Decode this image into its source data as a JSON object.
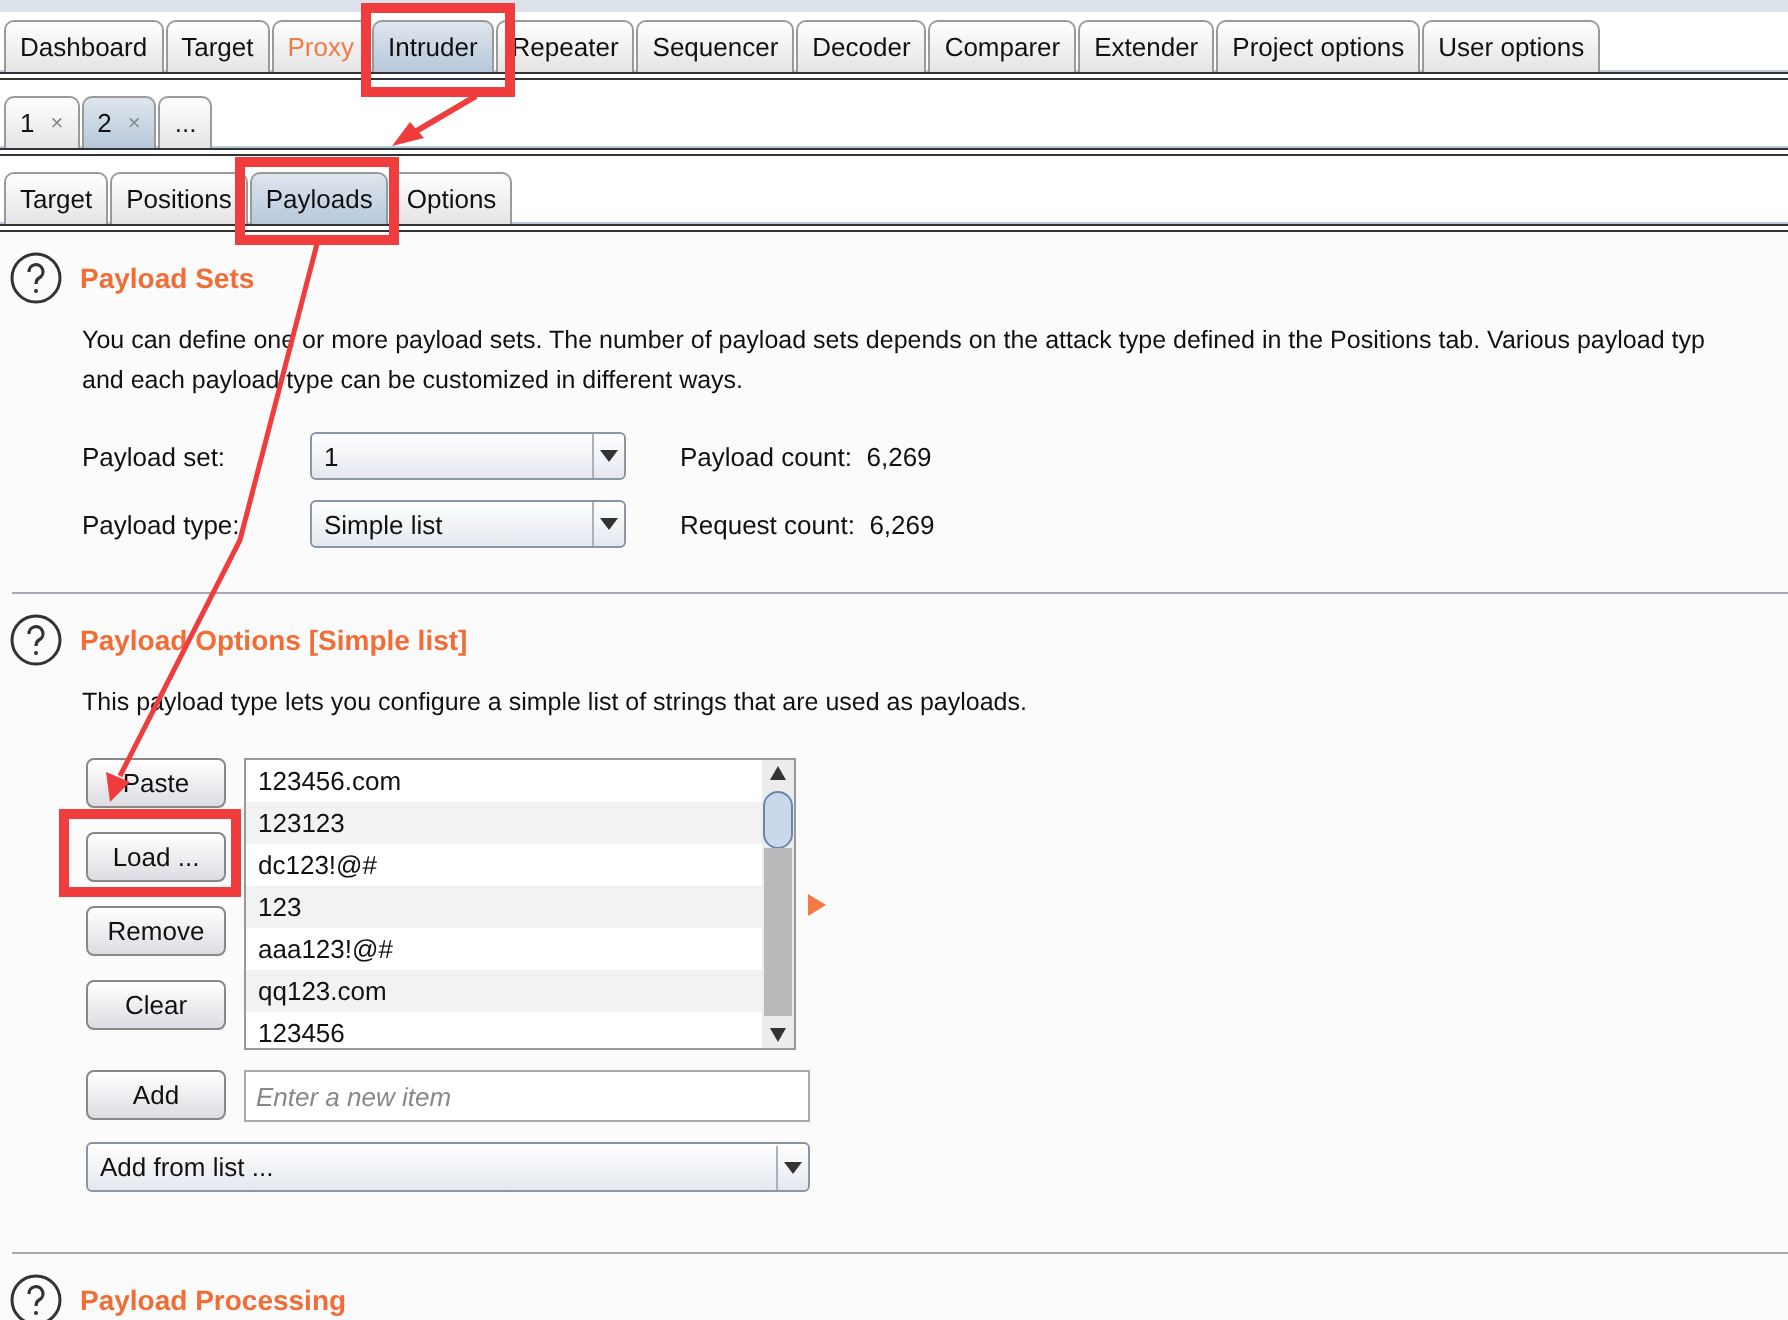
{
  "main_tabs": [
    {
      "label": "Dashboard",
      "selected": false,
      "highlighted": false
    },
    {
      "label": "Target",
      "selected": false,
      "highlighted": false
    },
    {
      "label": "Proxy",
      "selected": false,
      "highlighted": true
    },
    {
      "label": "Intruder",
      "selected": true,
      "highlighted": false
    },
    {
      "label": "Repeater",
      "selected": false,
      "highlighted": false
    },
    {
      "label": "Sequencer",
      "selected": false,
      "highlighted": false
    },
    {
      "label": "Decoder",
      "selected": false,
      "highlighted": false
    },
    {
      "label": "Comparer",
      "selected": false,
      "highlighted": false
    },
    {
      "label": "Extender",
      "selected": false,
      "highlighted": false
    },
    {
      "label": "Project options",
      "selected": false,
      "highlighted": false
    },
    {
      "label": "User options",
      "selected": false,
      "highlighted": false
    }
  ],
  "attack_tabs": [
    {
      "label": "1",
      "close": "×",
      "selected": false
    },
    {
      "label": "2",
      "close": "×",
      "selected": true
    },
    {
      "label": "...",
      "selected": false
    }
  ],
  "sub_tabs": [
    {
      "label": "Target",
      "selected": false
    },
    {
      "label": "Positions",
      "selected": false
    },
    {
      "label": "Payloads",
      "selected": true
    },
    {
      "label": "Options",
      "selected": false
    }
  ],
  "payload_sets": {
    "title": "Payload Sets",
    "description": [
      "You can define one or more payload sets. The number of payload sets depends on the attack type defined in the Positions tab. Various payload typ",
      "and each payload type can be customized in different ways."
    ],
    "fields": [
      {
        "label": "Payload set:",
        "value": "1",
        "count_label": "Payload count:",
        "count": "6,269"
      },
      {
        "label": "Payload type:",
        "value": "Simple list",
        "count_label": "Request count:",
        "count": "6,269"
      }
    ]
  },
  "payload_options": {
    "title": "Payload Options [Simple list]",
    "description": "This payload type lets you configure a simple list of strings that are used as payloads.",
    "buttons": [
      "Paste",
      "Load ...",
      "Remove",
      "Clear"
    ],
    "items": [
      "123456.com",
      "123123",
      "dc123!@#",
      "123",
      "aaa123!@#",
      "qq123.com",
      "123456"
    ],
    "add_button": "Add",
    "new_item": {
      "placeholder": "Enter a new item"
    },
    "add_from_list": "Add from list ..."
  },
  "payload_processing": {
    "title": "Payload Processing"
  }
}
